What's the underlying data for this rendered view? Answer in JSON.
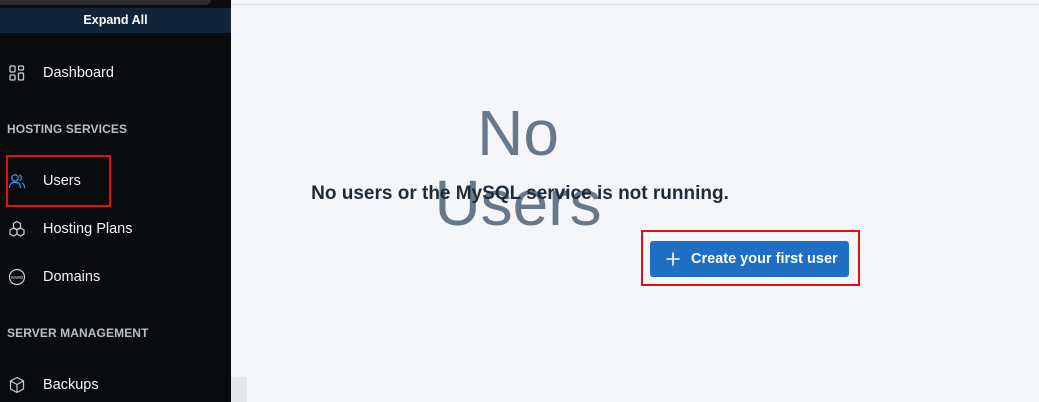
{
  "sidebar": {
    "expand_label": "Expand All",
    "items": [
      {
        "label": "Dashboard",
        "icon": "dashboard-icon"
      },
      {
        "label": "Users",
        "icon": "users-icon"
      },
      {
        "label": "Hosting Plans",
        "icon": "hosting-plans-icon"
      },
      {
        "label": "Domains",
        "icon": "www-icon"
      },
      {
        "label": "Backups",
        "icon": "backups-icon"
      }
    ],
    "sections": {
      "hosting": "HOSTING SERVICES",
      "server": "SERVER MANAGEMENT"
    },
    "icon_color": "#c9ced6",
    "active_icon_color": "#3f8de0"
  },
  "main": {
    "empty_title": "No Users",
    "empty_subtitle": "No users or the MySQL service is not running.",
    "create_button_label": "Create your first user",
    "button_color": "#1f6fc5"
  },
  "highlight_color": "#e01010"
}
